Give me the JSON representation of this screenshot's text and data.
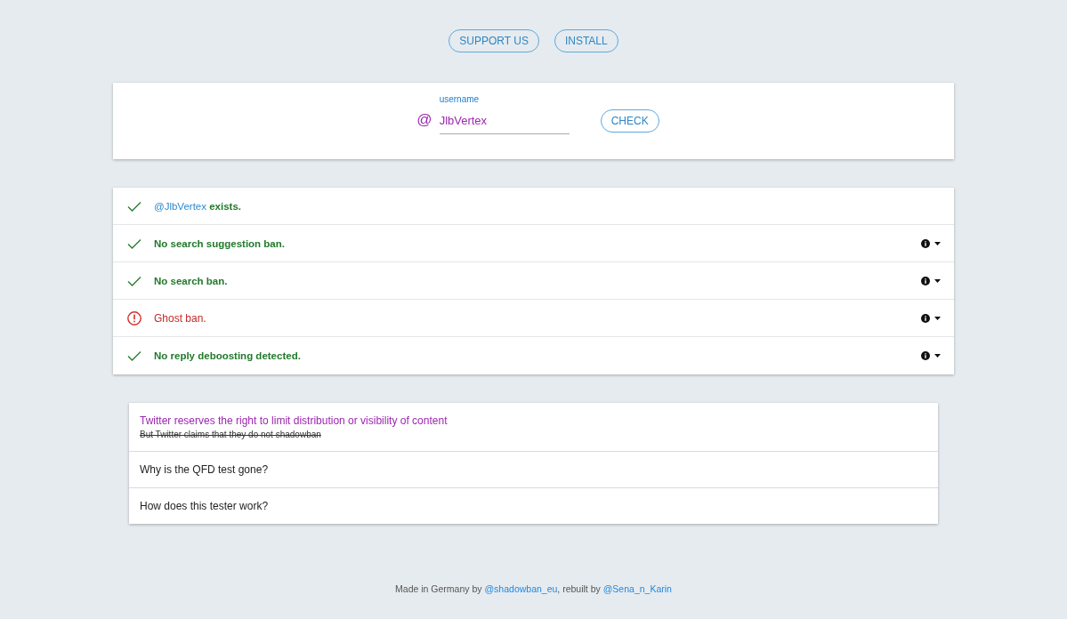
{
  "header_buttons": [
    {
      "label": "SUPPORT US"
    },
    {
      "label": "INSTALL"
    }
  ],
  "search": {
    "prefix": "@",
    "label": "username",
    "value": "JlbVertex",
    "button": "CHECK"
  },
  "results": [
    {
      "kind": "pass",
      "link": "@JlbVertex",
      "text": "exists.",
      "expandable": false
    },
    {
      "kind": "pass",
      "text": "No search suggestion ban.",
      "expandable": true
    },
    {
      "kind": "pass",
      "text": "No search ban.",
      "expandable": true
    },
    {
      "kind": "fail",
      "text": "Ghost ban.",
      "expandable": true
    },
    {
      "kind": "pass",
      "text": "No reply deboosting detected.",
      "expandable": true
    }
  ],
  "faq": [
    {
      "kind": "notice",
      "title": "Twitter reserves the right to limit distribution or visibility of content",
      "note": {
        "text": "But Twitter claims that they do not shadowban",
        "struck": true
      }
    },
    {
      "kind": "question",
      "title": "Why is the QFD test gone?"
    },
    {
      "kind": "question",
      "title": "How does this tester work?"
    }
  ],
  "footer": {
    "segments": [
      {
        "kind": "text",
        "text": "Made in Germany by "
      },
      {
        "kind": "link",
        "text": "@shadowban_eu"
      },
      {
        "kind": "text",
        "text": ", rebuilt by "
      },
      {
        "kind": "link",
        "text": "@Sena_n_Karin"
      }
    ]
  }
}
